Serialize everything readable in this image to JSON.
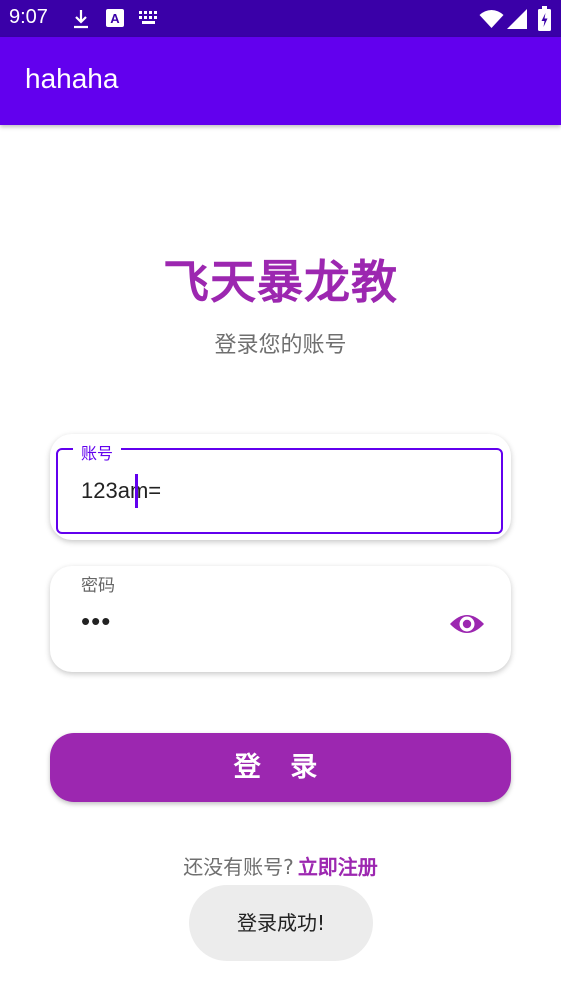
{
  "status_bar": {
    "time": "9:07",
    "icons": [
      "download-icon",
      "a-icon",
      "keyboard-icon",
      "wifi-icon",
      "signal-icon",
      "battery-icon"
    ]
  },
  "app_bar": {
    "title": "hahaha"
  },
  "login": {
    "heading": "飞天暴龙教",
    "subheading": "登录您的账号",
    "account_label": "账号",
    "account_value": "123am=",
    "password_label": "密码",
    "password_value": "•••",
    "login_button": "登 录",
    "register_prompt": "还没有账号?",
    "register_link": "立即注册"
  },
  "toast": {
    "message": "登录成功!"
  },
  "colors": {
    "status_bar": "#3a00a8",
    "app_bar": "#6200ee",
    "accent": "#9c27b0",
    "focus_outline": "#6200ee"
  }
}
